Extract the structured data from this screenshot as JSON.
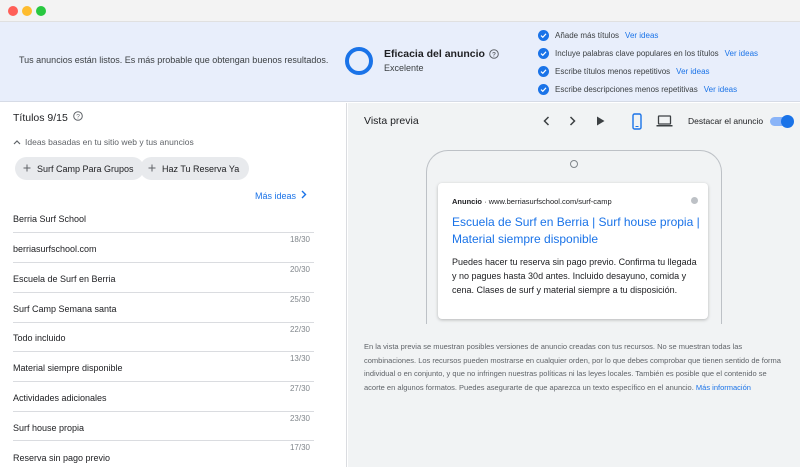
{
  "banner": {
    "message": "Tus anuncios están listos. Es más probable que obtengan buenos resultados.",
    "effectiveness_title": "Eficacia del anuncio",
    "effectiveness_status": "Excelente",
    "checklist": [
      {
        "text": "Añade más títulos",
        "link": "Ver ideas"
      },
      {
        "text": "Incluye palabras clave populares en los títulos",
        "link": "Ver ideas"
      },
      {
        "text": "Escribe títulos menos repetitivos",
        "link": "Ver ideas"
      },
      {
        "text": "Escribe descripciones menos repetitivas",
        "link": "Ver ideas"
      }
    ]
  },
  "titles": {
    "header": "Títulos 9/15",
    "ideas_label": "Ideas basadas en tu sitio web y tus anuncios",
    "chips": [
      "Surf Camp Para Grupos",
      "Haz Tu Reserva Ya"
    ],
    "more_ideas": "Más ideas",
    "rows": [
      {
        "text": "Berria Surf School",
        "count": "18/30"
      },
      {
        "text": "berriasurfschool.com",
        "count": "20/30"
      },
      {
        "text": "Escuela de Surf en Berria",
        "count": "25/30"
      },
      {
        "text": "Surf Camp Semana santa",
        "count": "22/30"
      },
      {
        "text": "Todo incluido",
        "count": "13/30"
      },
      {
        "text": "Material siempre disponible",
        "count": "27/30"
      },
      {
        "text": "Actividades adicionales",
        "count": "23/30"
      },
      {
        "text": "Surf house propia",
        "count": "17/30"
      },
      {
        "text": "Reserva sin pago previo",
        "count": ""
      }
    ]
  },
  "preview": {
    "title": "Vista previa",
    "highlight_label": "Destacar el anuncio",
    "highlight_on": true,
    "ad": {
      "badge": "Anuncio",
      "url": "www.berriasurfschool.com/surf-camp",
      "headline": "Escuela de Surf en Berria | Surf house propia | Material siempre disponible",
      "description": "Puedes hacer tu reserva sin pago previo. Confirma tu llegada y no pagues hasta 30d antes. Incluido desayuno, comida y cena. Clases de surf y material siempre a tu disposición."
    },
    "note": "En la vista previa se muestran posibles versiones de anuncio creadas con tus recursos. No se muestran todas las combinaciones. Los recursos pueden mostrarse en cualquier orden, por lo que debes comprobar que tienen sentido de forma individual o en conjunto, y que no infringen nuestras políticas ni las leyes locales. También es posible que el contenido se acorte en algunos formatos. Puedes asegurarte de que aparezca un texto específico en el anuncio.",
    "note_link": "Más información"
  },
  "colors": {
    "accent": "#1a73e8",
    "banner_bg": "#e8eefb",
    "close": "#ff5f57",
    "minimize": "#febc2e",
    "zoom": "#28c840"
  }
}
